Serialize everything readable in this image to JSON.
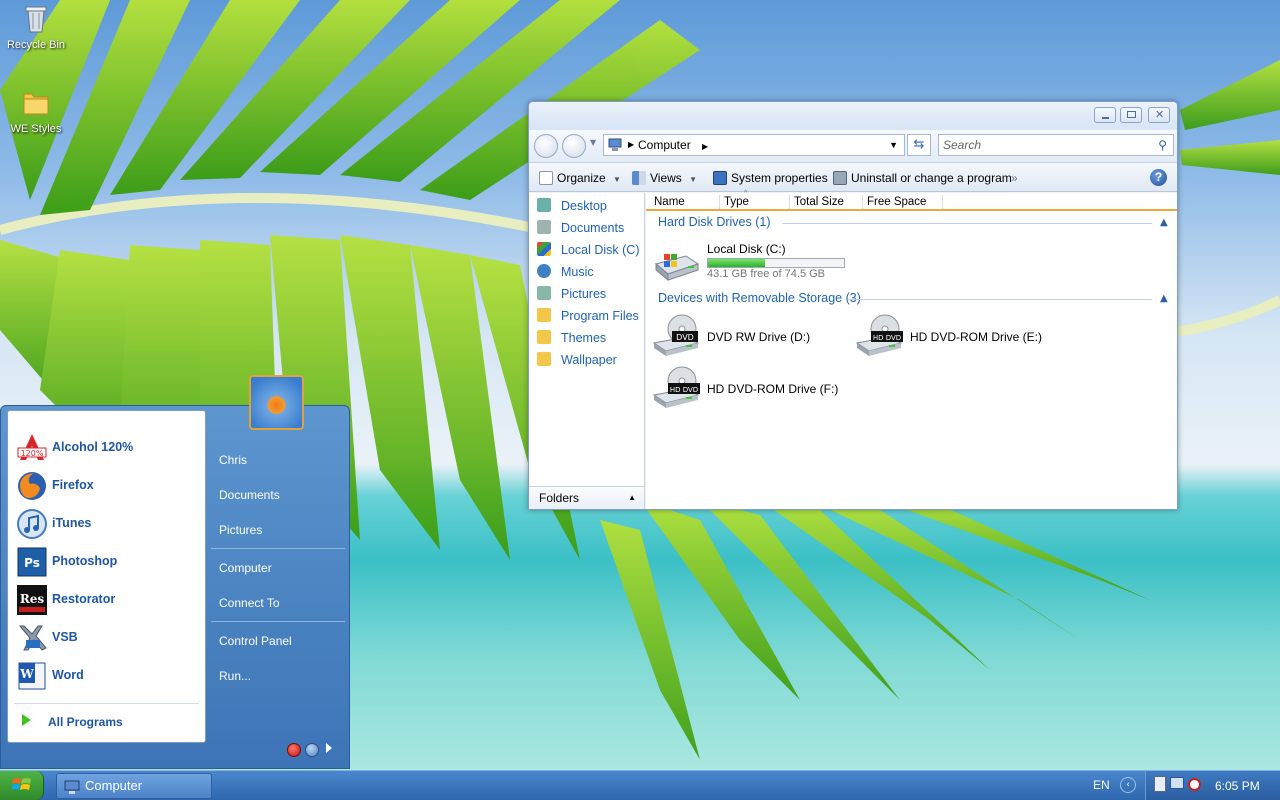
{
  "desktop": {
    "icons": [
      {
        "label": "Recycle Bin",
        "icon": "recycle-bin-icon"
      },
      {
        "label": "WE Styles",
        "icon": "folder-icon"
      }
    ]
  },
  "explorer": {
    "address": {
      "location": "Computer"
    },
    "search": {
      "placeholder": "Search"
    },
    "toolbar": {
      "organize": "Organize",
      "views": "Views",
      "system_properties": "System properties",
      "uninstall": "Uninstall or change a program",
      "overflow": "»"
    },
    "nav": {
      "items": [
        {
          "label": "Desktop",
          "icon": "desktop-icon"
        },
        {
          "label": "Documents",
          "icon": "documents-icon"
        },
        {
          "label": "Local Disk (C)",
          "icon": "local-disk-icon"
        },
        {
          "label": "Music",
          "icon": "music-icon"
        },
        {
          "label": "Pictures",
          "icon": "pictures-icon"
        },
        {
          "label": "Program Files",
          "icon": "folder-icon"
        },
        {
          "label": "Themes",
          "icon": "folder-icon"
        },
        {
          "label": "Wallpaper",
          "icon": "folder-icon"
        }
      ],
      "folders_label": "Folders"
    },
    "columns": [
      "Name",
      "Type",
      "Total Size",
      "Free Space"
    ],
    "groups": {
      "hard_disks": {
        "title": "Hard Disk Drives (1)",
        "drives": [
          {
            "name": "Local Disk (C:)",
            "free_text": "43.1 GB free of 74.5 GB",
            "used_fraction": 0.42
          }
        ]
      },
      "removable": {
        "title": "Devices with Removable Storage (3)",
        "drives": [
          {
            "name": "DVD RW Drive (D:)",
            "badge": "DVD"
          },
          {
            "name": "HD DVD-ROM Drive (E:)",
            "badge": "HD DVD"
          },
          {
            "name": "HD DVD-ROM Drive (F:)",
            "badge": "HD DVD"
          }
        ]
      }
    }
  },
  "start_menu": {
    "programs": [
      {
        "label": "Alcohol 120%",
        "icon": "alcohol-120-icon"
      },
      {
        "label": "Firefox",
        "icon": "firefox-icon"
      },
      {
        "label": "iTunes",
        "icon": "itunes-icon"
      },
      {
        "label": "Photoshop",
        "icon": "photoshop-icon"
      },
      {
        "label": "Restorator",
        "icon": "restorator-icon"
      },
      {
        "label": "VSB",
        "icon": "vsb-icon"
      },
      {
        "label": "Word",
        "icon": "word-icon"
      }
    ],
    "all_programs": "All Programs",
    "right": {
      "user": "Chris",
      "documents": "Documents",
      "pictures": "Pictures",
      "computer": "Computer",
      "connect": "Connect To",
      "control_panel": "Control Panel",
      "run": "Run..."
    }
  },
  "taskbar": {
    "tasks": [
      {
        "label": "Computer",
        "icon": "computer-icon"
      }
    ],
    "language": "EN",
    "clock": "6:05 PM"
  },
  "colors": {
    "accent": "#1d62b6",
    "taskbar": "#3a74bb",
    "start_green": "#3f9f37",
    "disk_fill": "#3fc53a"
  }
}
